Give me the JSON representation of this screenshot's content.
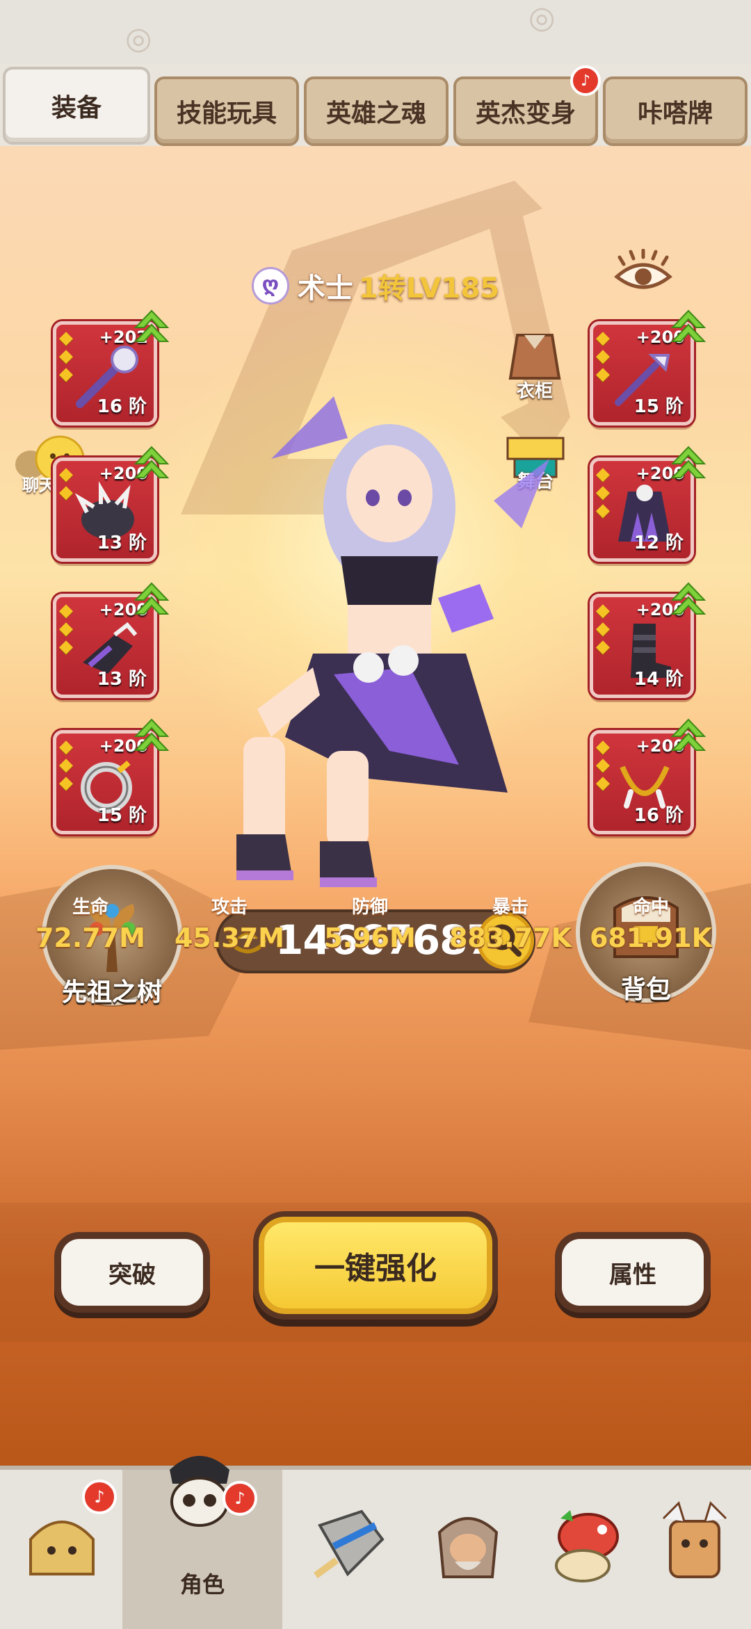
{
  "tabs": [
    {
      "label": "装备",
      "active": true
    },
    {
      "label": "技能玩具",
      "active": false
    },
    {
      "label": "英雄之魂",
      "active": false
    },
    {
      "label": "英杰变身",
      "active": false,
      "badge": "bell-icon"
    },
    {
      "label": "咔嗒牌",
      "active": false
    }
  ],
  "character": {
    "class_name": "术士",
    "level": "1转LV185"
  },
  "equipment_left": [
    {
      "plus": "+202",
      "grade": "16 阶",
      "icon": "staff-icon"
    },
    {
      "plus": "+200",
      "grade": "13 阶",
      "icon": "spiked-helmet-icon"
    },
    {
      "plus": "+200",
      "grade": "13 阶",
      "icon": "gauntlet-icon"
    },
    {
      "plus": "+200",
      "grade": "15 阶",
      "icon": "ring-icon"
    }
  ],
  "equipment_right": [
    {
      "plus": "+200",
      "grade": "15 阶",
      "icon": "wand-icon"
    },
    {
      "plus": "+200",
      "grade": "12 阶",
      "icon": "robe-icon"
    },
    {
      "plus": "+200",
      "grade": "14 阶",
      "icon": "boots-icon"
    },
    {
      "plus": "+200",
      "grade": "16 阶",
      "icon": "necklace-icon"
    }
  ],
  "side_buttons": {
    "wardrobe": "衣柜",
    "stage": "舞台",
    "chat": "聊天"
  },
  "ancestor_tree": "先祖之树",
  "backpack": "背包",
  "gold": "146676870",
  "stats": [
    {
      "label": "生命",
      "value": "72.77M"
    },
    {
      "label": "攻击",
      "value": "45.37M"
    },
    {
      "label": "防御",
      "value": "5.96M"
    },
    {
      "label": "暴击",
      "value": "883.77K"
    },
    {
      "label": "命中",
      "value": "681.91K"
    }
  ],
  "actions": {
    "breakthrough": "突破",
    "enhance_all": "一键强化",
    "attributes": "属性"
  },
  "bottom_nav": [
    {
      "label": "",
      "icon": "caveman-icon",
      "badge": true
    },
    {
      "label": "角色",
      "icon": "skull-hero-icon",
      "badge": true,
      "active": true
    },
    {
      "label": "",
      "icon": "armor-icon",
      "badge": false
    },
    {
      "label": "",
      "icon": "elder-icon",
      "badge": false
    },
    {
      "label": "",
      "icon": "dino-icon",
      "badge": false
    },
    {
      "label": "",
      "icon": "totem-icon",
      "badge": false
    }
  ],
  "colors": {
    "slot_red": "#c22d33",
    "gold_text": "#fbd24e",
    "enhance_yellow": "#f5c934",
    "badge_red": "#e33a2c"
  }
}
